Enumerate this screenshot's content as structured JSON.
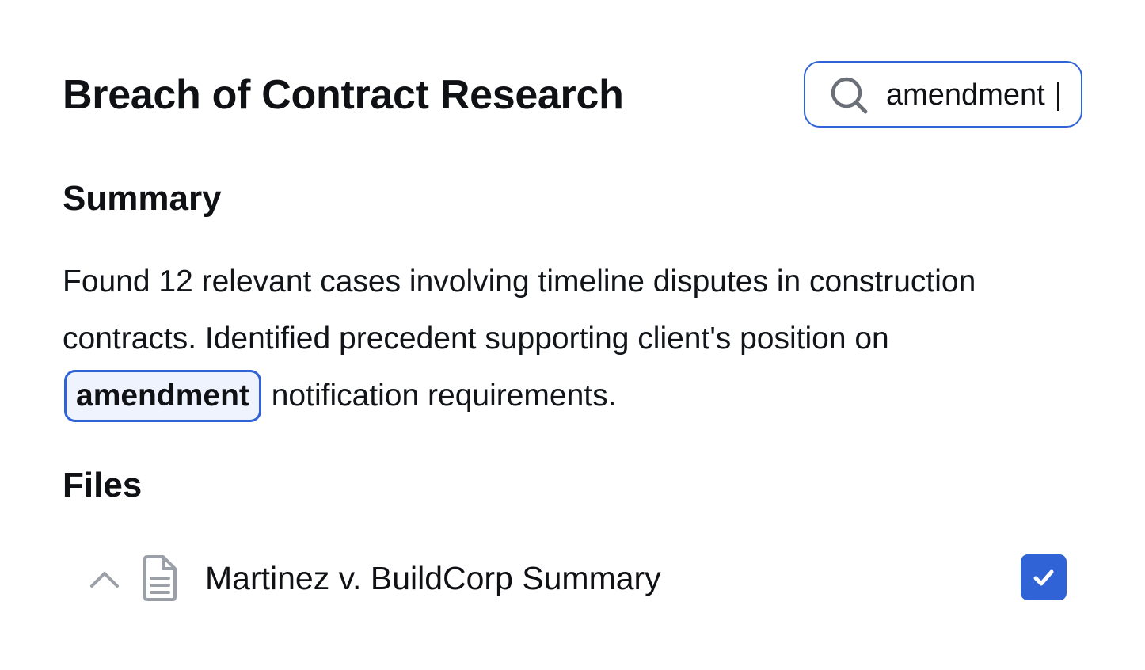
{
  "header": {
    "title": "Breach of Contract Research"
  },
  "search": {
    "value": "amendment",
    "icon": "search-icon"
  },
  "summary": {
    "heading": "Summary",
    "text_before": "Found 12 relevant cases involving timeline disputes in construction contracts. Identified precedent supporting client's position on",
    "highlight": "amendment",
    "text_after": "notification requirements."
  },
  "files": {
    "heading": "Files",
    "items": [
      {
        "name": "Martinez v. BuildCorp Summary",
        "expanded": true,
        "checked": true,
        "icons": [
          "chevron-up-icon",
          "document-icon",
          "check-icon"
        ]
      }
    ]
  },
  "colors": {
    "accent": "#2f63d6",
    "highlight_bg": "#eef3fd",
    "text": "#0f1115",
    "icon_gray": "#8a8f98"
  }
}
